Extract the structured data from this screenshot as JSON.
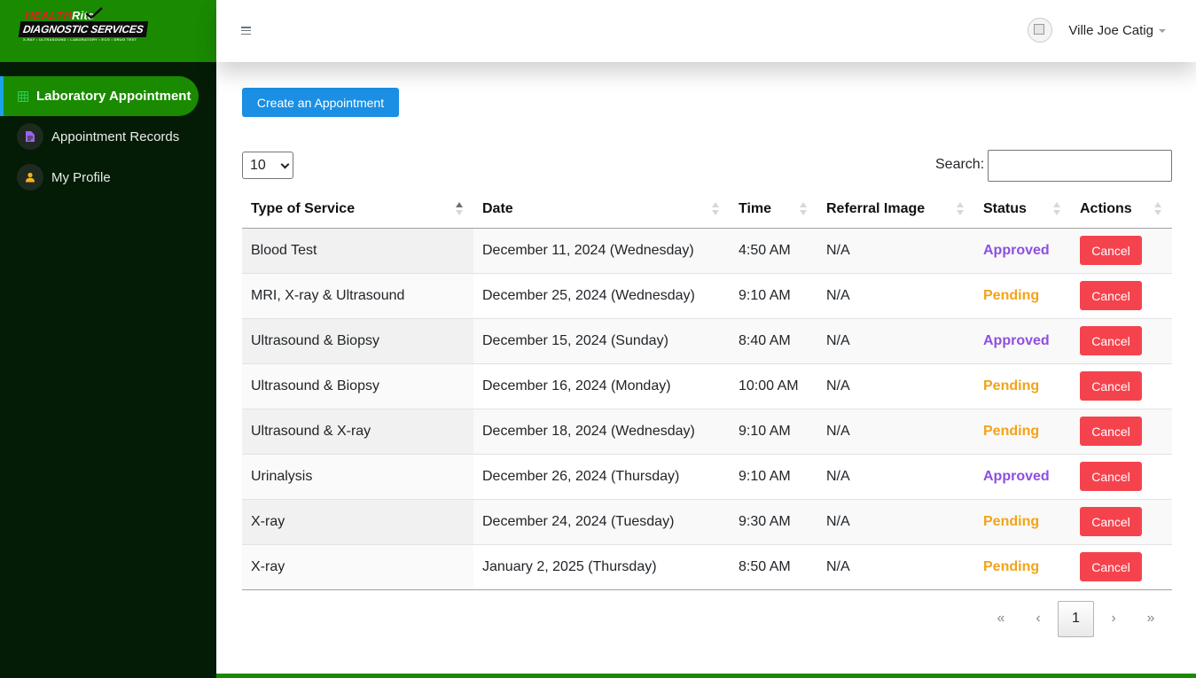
{
  "brand": {
    "line1_red": "HEALTH",
    "line1_white": "Rite",
    "line2": "DIAGNOSTIC SERVICES",
    "line3": "X-RAY • ULTRASOUND • LABORATORY • ECG • DRUG TEST",
    "colors": {
      "header": "#1a8a00",
      "sidebar": "#041b06"
    }
  },
  "sidebar": {
    "items": [
      {
        "label": "Laboratory Appointment",
        "icon": "table-icon",
        "active": true
      },
      {
        "label": "Appointment Records",
        "icon": "document-icon",
        "active": false
      },
      {
        "label": "My Profile",
        "icon": "user-icon",
        "active": false
      }
    ]
  },
  "topbar": {
    "menu_icon": "hamburger-icon",
    "user_name": "Ville Joe Catig"
  },
  "toolbar": {
    "create_label": "Create an Appointment",
    "page_length": "10",
    "search_label": "Search:",
    "search_value": ""
  },
  "table": {
    "headers": [
      "Type of Service",
      "Date",
      "Time",
      "Referral Image",
      "Status",
      "Actions"
    ],
    "rows": [
      {
        "service": "Blood Test",
        "date": "December 11, 2024 (Wednesday)",
        "time": "4:50 AM",
        "referral": "N/A",
        "status": "Approved",
        "action": "Cancel"
      },
      {
        "service": "MRI, X-ray & Ultrasound",
        "date": "December 25, 2024 (Wednesday)",
        "time": "9:10 AM",
        "referral": "N/A",
        "status": "Pending",
        "action": "Cancel"
      },
      {
        "service": "Ultrasound & Biopsy",
        "date": "December 15, 2024 (Sunday)",
        "time": "8:40 AM",
        "referral": "N/A",
        "status": "Approved",
        "action": "Cancel"
      },
      {
        "service": "Ultrasound & Biopsy",
        "date": "December 16, 2024 (Monday)",
        "time": "10:00 AM",
        "referral": "N/A",
        "status": "Pending",
        "action": "Cancel"
      },
      {
        "service": "Ultrasound & X-ray",
        "date": "December 18, 2024 (Wednesday)",
        "time": "9:10 AM",
        "referral": "N/A",
        "status": "Pending",
        "action": "Cancel"
      },
      {
        "service": "Urinalysis",
        "date": "December 26, 2024 (Thursday)",
        "time": "9:10 AM",
        "referral": "N/A",
        "status": "Approved",
        "action": "Cancel"
      },
      {
        "service": "X-ray",
        "date": "December 24, 2024 (Tuesday)",
        "time": "9:30 AM",
        "referral": "N/A",
        "status": "Pending",
        "action": "Cancel"
      },
      {
        "service": "X-ray",
        "date": "January 2, 2025 (Thursday)",
        "time": "8:50 AM",
        "referral": "N/A",
        "status": "Pending",
        "action": "Cancel"
      }
    ],
    "status_colors": {
      "Approved": "#8e4fe0",
      "Pending": "#f4a317"
    }
  },
  "pagination": {
    "first": "«",
    "prev": "‹",
    "current": "1",
    "next": "›",
    "last": "»"
  }
}
